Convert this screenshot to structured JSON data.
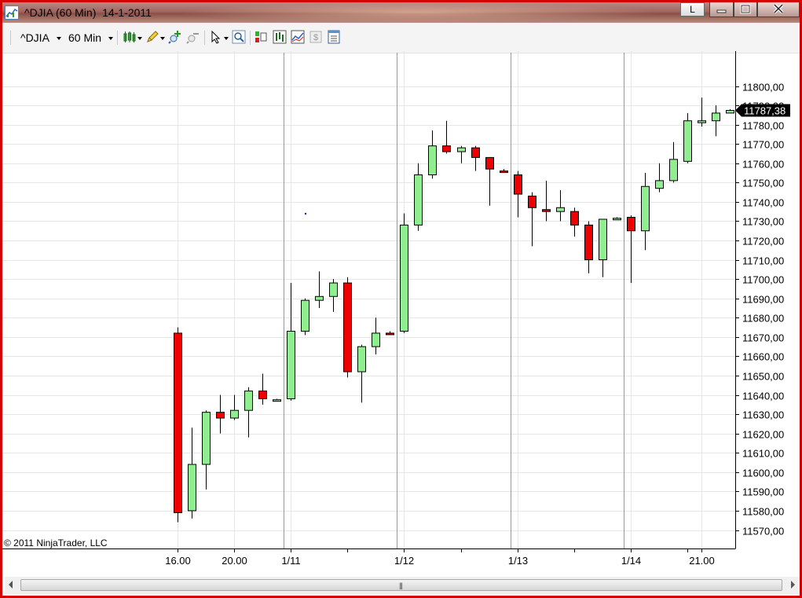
{
  "window": {
    "title": "^DJIA (60 Min)  14-1-2011",
    "lang_button": "L"
  },
  "toolbar": {
    "instrument": "^DJIA",
    "interval": "60 Min"
  },
  "chart_data": {
    "type": "candlestick",
    "instrument": "^DJIA",
    "interval": "60 Min",
    "y_axis": {
      "position": "right",
      "range": [
        11565,
        11805
      ],
      "ticks": [
        "11570,00",
        "11580,00",
        "11590,00",
        "11600,00",
        "11610,00",
        "11620,00",
        "11630,00",
        "11640,00",
        "11650,00",
        "11660,00",
        "11670,00",
        "11680,00",
        "11690,00",
        "11700,00",
        "11710,00",
        "11720,00",
        "11730,00",
        "11740,00",
        "11750,00",
        "11760,00",
        "11770,00",
        "11780,00",
        "11790,00",
        "11800,00"
      ],
      "tick_values": [
        11570,
        11580,
        11590,
        11600,
        11610,
        11620,
        11630,
        11640,
        11650,
        11660,
        11670,
        11680,
        11690,
        11700,
        11710,
        11720,
        11730,
        11740,
        11750,
        11760,
        11770,
        11780,
        11790,
        11800
      ],
      "last_price_label": "11787,38",
      "last_price": 11787.38
    },
    "x_axis": {
      "labels": [
        {
          "text": "16.00",
          "bar": 0
        },
        {
          "text": "20.00",
          "bar": 4
        },
        {
          "text": "1/11",
          "bar": 8
        },
        {
          "text": "1/12",
          "bar": 16
        },
        {
          "text": "1/13",
          "bar": 24
        },
        {
          "text": "1/14",
          "bar": 32
        },
        {
          "text": "21.00",
          "bar": 37
        }
      ],
      "session_breaks": [
        7,
        15,
        23,
        31
      ]
    },
    "grid": true,
    "bullish_color": "#90ee90",
    "bearish_color": "#ee0000",
    "bars": [
      {
        "o": 11672,
        "h": 11675,
        "l": 11574,
        "c": 11579
      },
      {
        "o": 11580,
        "h": 11623,
        "l": 11576,
        "c": 11604
      },
      {
        "o": 11604,
        "h": 11632,
        "l": 11591,
        "c": 11631
      },
      {
        "o": 11631,
        "h": 11640,
        "l": 11620,
        "c": 11628
      },
      {
        "o": 11628,
        "h": 11640,
        "l": 11627,
        "c": 11632
      },
      {
        "o": 11632,
        "h": 11644,
        "l": 11618,
        "c": 11642
      },
      {
        "o": 11642,
        "h": 11651,
        "l": 11635,
        "c": 11638
      },
      {
        "o": 11637.5,
        "h": 11638,
        "l": 11637,
        "c": 11637.5
      },
      {
        "o": 11638,
        "h": 11698,
        "l": 11637,
        "c": 11673
      },
      {
        "o": 11673,
        "h": 11690,
        "l": 11671,
        "c": 11689
      },
      {
        "o": 11689,
        "h": 11704,
        "l": 11685,
        "c": 11691
      },
      {
        "o": 11691,
        "h": 11700,
        "l": 11683,
        "c": 11698
      },
      {
        "o": 11698,
        "h": 11701,
        "l": 11649,
        "c": 11652
      },
      {
        "o": 11652,
        "h": 11666,
        "l": 11636,
        "c": 11665
      },
      {
        "o": 11665,
        "h": 11680,
        "l": 11661,
        "c": 11672
      },
      {
        "o": 11672,
        "h": 11673,
        "l": 11671,
        "c": 11671.5
      },
      {
        "o": 11673,
        "h": 11734,
        "l": 11672,
        "c": 11728
      },
      {
        "o": 11728,
        "h": 11760,
        "l": 11725,
        "c": 11754
      },
      {
        "o": 11754,
        "h": 11777,
        "l": 11752,
        "c": 11769
      },
      {
        "o": 11769,
        "h": 11782,
        "l": 11765,
        "c": 11766
      },
      {
        "o": 11766,
        "h": 11769,
        "l": 11760,
        "c": 11768
      },
      {
        "o": 11768,
        "h": 11769,
        "l": 11756,
        "c": 11763
      },
      {
        "o": 11763,
        "h": 11763,
        "l": 11738,
        "c": 11757
      },
      {
        "o": 11756,
        "h": 11757,
        "l": 11755,
        "c": 11755.5
      },
      {
        "o": 11754,
        "h": 11756,
        "l": 11732,
        "c": 11744
      },
      {
        "o": 11743,
        "h": 11745,
        "l": 11717,
        "c": 11737
      },
      {
        "o": 11736,
        "h": 11751,
        "l": 11730,
        "c": 11735
      },
      {
        "o": 11735,
        "h": 11746,
        "l": 11730,
        "c": 11737
      },
      {
        "o": 11735,
        "h": 11737,
        "l": 11722,
        "c": 11728
      },
      {
        "o": 11728,
        "h": 11730,
        "l": 11703,
        "c": 11710
      },
      {
        "o": 11710,
        "h": 11731,
        "l": 11701,
        "c": 11731
      },
      {
        "o": 11731.5,
        "h": 11732,
        "l": 11731,
        "c": 11731.5
      },
      {
        "o": 11732,
        "h": 11733,
        "l": 11698,
        "c": 11725
      },
      {
        "o": 11725,
        "h": 11755,
        "l": 11715,
        "c": 11748
      },
      {
        "o": 11747,
        "h": 11760,
        "l": 11745,
        "c": 11751
      },
      {
        "o": 11751,
        "h": 11771,
        "l": 11750,
        "c": 11762
      },
      {
        "o": 11761,
        "h": 11786,
        "l": 11760,
        "c": 11782
      },
      {
        "o": 11781,
        "h": 11794,
        "l": 11779,
        "c": 11782
      },
      {
        "o": 11782,
        "h": 11790,
        "l": 11774,
        "c": 11786
      },
      {
        "o": 11786,
        "h": 11788,
        "l": 11786,
        "c": 11787.38
      }
    ]
  },
  "footer": {
    "copyright": "© 2011 NinjaTrader, LLC"
  }
}
